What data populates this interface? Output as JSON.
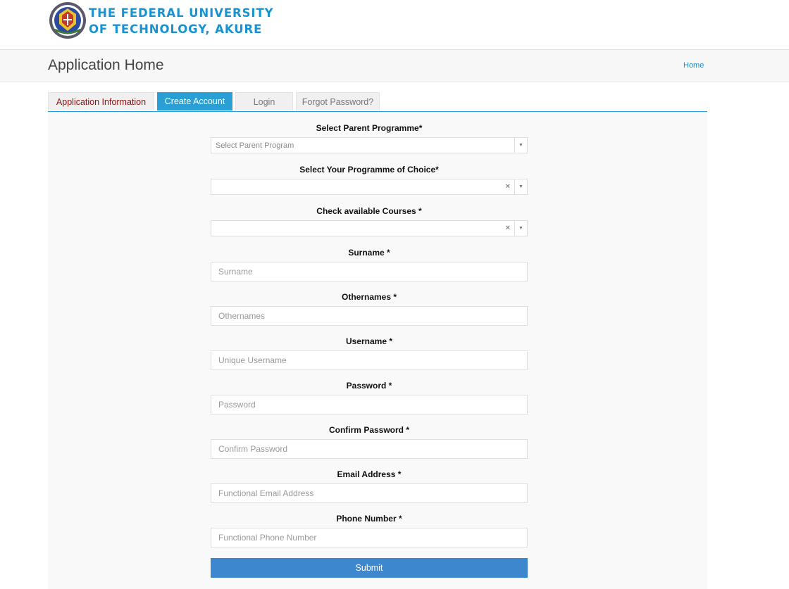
{
  "header": {
    "logo_icon": "university-crest-icon",
    "logo_line1": "THE FEDERAL UNIVERSITY",
    "logo_line2": "OF TECHNOLOGY, AKURE"
  },
  "titlebar": {
    "title": "Application Home",
    "breadcrumb": "Home"
  },
  "tabs": [
    {
      "label": "Application Information"
    },
    {
      "label": "Create Account"
    },
    {
      "label": "Login"
    },
    {
      "label": "Forgot Password?"
    }
  ],
  "form": {
    "parent_programme": {
      "label": "Select Parent Programme*",
      "placeholder": "Select Parent Program"
    },
    "programme_choice": {
      "label": "Select Your Programme of Choice*"
    },
    "courses": {
      "label": "Check available Courses *"
    },
    "surname": {
      "label": "Surname *",
      "placeholder": "Surname"
    },
    "othernames": {
      "label": "Othernames *",
      "placeholder": "Othernames"
    },
    "username": {
      "label": "Username *",
      "placeholder": "Unique Username"
    },
    "password": {
      "label": "Password *",
      "placeholder": "Password"
    },
    "confirm_password": {
      "label": "Confirm Password *",
      "placeholder": "Confirm Password"
    },
    "email": {
      "label": "Email Address *",
      "placeholder": "Functional Email Address"
    },
    "phone": {
      "label": "Phone Number *",
      "placeholder": "Functional Phone Number"
    },
    "submit_label": "Submit"
  },
  "colors": {
    "brand_blue": "#1a92d0",
    "active_tab": "#2a9fd6",
    "submit_button": "#3d87cf",
    "info_tab_text": "#8b1111"
  }
}
